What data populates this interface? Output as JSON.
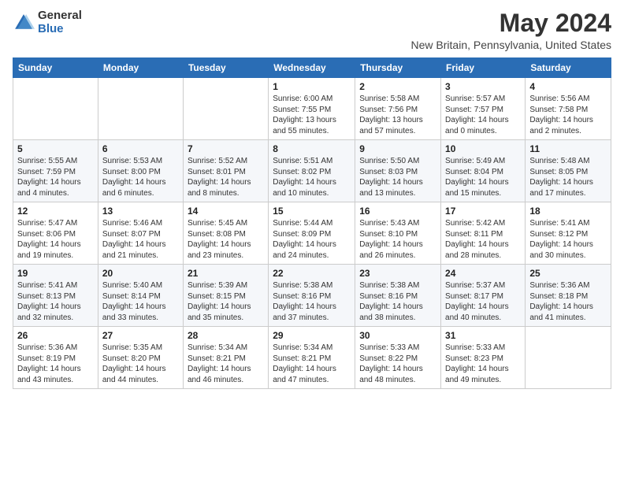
{
  "logo": {
    "general": "General",
    "blue": "Blue"
  },
  "title": "May 2024",
  "subtitle": "New Britain, Pennsylvania, United States",
  "headers": [
    "Sunday",
    "Monday",
    "Tuesday",
    "Wednesday",
    "Thursday",
    "Friday",
    "Saturday"
  ],
  "weeks": [
    [
      {
        "day": "",
        "info": ""
      },
      {
        "day": "",
        "info": ""
      },
      {
        "day": "",
        "info": ""
      },
      {
        "day": "1",
        "info": "Sunrise: 6:00 AM\nSunset: 7:55 PM\nDaylight: 13 hours\nand 55 minutes."
      },
      {
        "day": "2",
        "info": "Sunrise: 5:58 AM\nSunset: 7:56 PM\nDaylight: 13 hours\nand 57 minutes."
      },
      {
        "day": "3",
        "info": "Sunrise: 5:57 AM\nSunset: 7:57 PM\nDaylight: 14 hours\nand 0 minutes."
      },
      {
        "day": "4",
        "info": "Sunrise: 5:56 AM\nSunset: 7:58 PM\nDaylight: 14 hours\nand 2 minutes."
      }
    ],
    [
      {
        "day": "5",
        "info": "Sunrise: 5:55 AM\nSunset: 7:59 PM\nDaylight: 14 hours\nand 4 minutes."
      },
      {
        "day": "6",
        "info": "Sunrise: 5:53 AM\nSunset: 8:00 PM\nDaylight: 14 hours\nand 6 minutes."
      },
      {
        "day": "7",
        "info": "Sunrise: 5:52 AM\nSunset: 8:01 PM\nDaylight: 14 hours\nand 8 minutes."
      },
      {
        "day": "8",
        "info": "Sunrise: 5:51 AM\nSunset: 8:02 PM\nDaylight: 14 hours\nand 10 minutes."
      },
      {
        "day": "9",
        "info": "Sunrise: 5:50 AM\nSunset: 8:03 PM\nDaylight: 14 hours\nand 13 minutes."
      },
      {
        "day": "10",
        "info": "Sunrise: 5:49 AM\nSunset: 8:04 PM\nDaylight: 14 hours\nand 15 minutes."
      },
      {
        "day": "11",
        "info": "Sunrise: 5:48 AM\nSunset: 8:05 PM\nDaylight: 14 hours\nand 17 minutes."
      }
    ],
    [
      {
        "day": "12",
        "info": "Sunrise: 5:47 AM\nSunset: 8:06 PM\nDaylight: 14 hours\nand 19 minutes."
      },
      {
        "day": "13",
        "info": "Sunrise: 5:46 AM\nSunset: 8:07 PM\nDaylight: 14 hours\nand 21 minutes."
      },
      {
        "day": "14",
        "info": "Sunrise: 5:45 AM\nSunset: 8:08 PM\nDaylight: 14 hours\nand 23 minutes."
      },
      {
        "day": "15",
        "info": "Sunrise: 5:44 AM\nSunset: 8:09 PM\nDaylight: 14 hours\nand 24 minutes."
      },
      {
        "day": "16",
        "info": "Sunrise: 5:43 AM\nSunset: 8:10 PM\nDaylight: 14 hours\nand 26 minutes."
      },
      {
        "day": "17",
        "info": "Sunrise: 5:42 AM\nSunset: 8:11 PM\nDaylight: 14 hours\nand 28 minutes."
      },
      {
        "day": "18",
        "info": "Sunrise: 5:41 AM\nSunset: 8:12 PM\nDaylight: 14 hours\nand 30 minutes."
      }
    ],
    [
      {
        "day": "19",
        "info": "Sunrise: 5:41 AM\nSunset: 8:13 PM\nDaylight: 14 hours\nand 32 minutes."
      },
      {
        "day": "20",
        "info": "Sunrise: 5:40 AM\nSunset: 8:14 PM\nDaylight: 14 hours\nand 33 minutes."
      },
      {
        "day": "21",
        "info": "Sunrise: 5:39 AM\nSunset: 8:15 PM\nDaylight: 14 hours\nand 35 minutes."
      },
      {
        "day": "22",
        "info": "Sunrise: 5:38 AM\nSunset: 8:16 PM\nDaylight: 14 hours\nand 37 minutes."
      },
      {
        "day": "23",
        "info": "Sunrise: 5:38 AM\nSunset: 8:16 PM\nDaylight: 14 hours\nand 38 minutes."
      },
      {
        "day": "24",
        "info": "Sunrise: 5:37 AM\nSunset: 8:17 PM\nDaylight: 14 hours\nand 40 minutes."
      },
      {
        "day": "25",
        "info": "Sunrise: 5:36 AM\nSunset: 8:18 PM\nDaylight: 14 hours\nand 41 minutes."
      }
    ],
    [
      {
        "day": "26",
        "info": "Sunrise: 5:36 AM\nSunset: 8:19 PM\nDaylight: 14 hours\nand 43 minutes."
      },
      {
        "day": "27",
        "info": "Sunrise: 5:35 AM\nSunset: 8:20 PM\nDaylight: 14 hours\nand 44 minutes."
      },
      {
        "day": "28",
        "info": "Sunrise: 5:34 AM\nSunset: 8:21 PM\nDaylight: 14 hours\nand 46 minutes."
      },
      {
        "day": "29",
        "info": "Sunrise: 5:34 AM\nSunset: 8:21 PM\nDaylight: 14 hours\nand 47 minutes."
      },
      {
        "day": "30",
        "info": "Sunrise: 5:33 AM\nSunset: 8:22 PM\nDaylight: 14 hours\nand 48 minutes."
      },
      {
        "day": "31",
        "info": "Sunrise: 5:33 AM\nSunset: 8:23 PM\nDaylight: 14 hours\nand 49 minutes."
      },
      {
        "day": "",
        "info": ""
      }
    ]
  ]
}
